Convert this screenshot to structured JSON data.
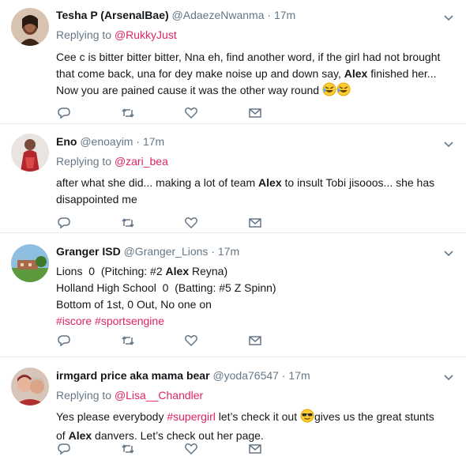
{
  "tweets": [
    {
      "name": "Tesha P (ArsenalBae)",
      "handle": "@AdaezeNwanma",
      "dot": "·",
      "time": "17m",
      "replying_label": "Replying to",
      "replying_to": "@RukkyJust",
      "text_a": "Cee c is bitter bitter bitter, Nna eh, find another word, if the girl had not brought that come back, una for dey make noise up and down say, ",
      "bold": "Alex",
      "text_b": " finished her... Now you are pained cause it was the other way round ",
      "emoji": [
        "rolling-on-floor-laughing-emoji",
        "rolling-on-floor-laughing-emoji"
      ]
    },
    {
      "name": "Eno",
      "handle": "@enoayim",
      "dot": "·",
      "time": "17m",
      "replying_label": "Replying to",
      "replying_to": "@zari_bea",
      "text_a": "after what she did... making a lot of team ",
      "bold": "Alex",
      "text_b": " to insult Tobi jisooos... she has disappointed me"
    },
    {
      "name": "Granger ISD",
      "handle": "@Granger_Lions",
      "dot": "·",
      "time": "17m",
      "lines": [
        {
          "a": "Lions  0  (Pitching: #2 ",
          "bold": "Alex",
          "b": " Reyna)"
        },
        {
          "a": "Holland High School  0  (Batting: #5 Z Spinn)"
        },
        {
          "a": "Bottom of 1st, 0 Out, No one on"
        }
      ],
      "hashtags": [
        "#iscore",
        "#sportsengine"
      ]
    },
    {
      "name": "irmgard price aka mama bear",
      "handle": "@yoda76547",
      "dot": "·",
      "time": "17m",
      "replying_label": "Replying to",
      "replying_to": "@Lisa__Chandler",
      "text_a": "Yes please everybody ",
      "hashtag": "#supergirl",
      "text_b": " let’s check it out ",
      "emoji": "smiling-face-with-sunglasses-emoji",
      "text_c": "gives us the great stunts of ",
      "bold": "Alex",
      "text_d": " danvers. Let’s check out her page."
    }
  ],
  "icons": {
    "reply": "reply-icon",
    "retweet": "retweet-icon",
    "like": "heart-icon",
    "dm": "envelope-icon",
    "more": "chevron-down-icon"
  },
  "colors": {
    "link": "#e0245e",
    "secondary_text": "#657786",
    "icon": "#657786",
    "border": "#e6ecf0"
  }
}
